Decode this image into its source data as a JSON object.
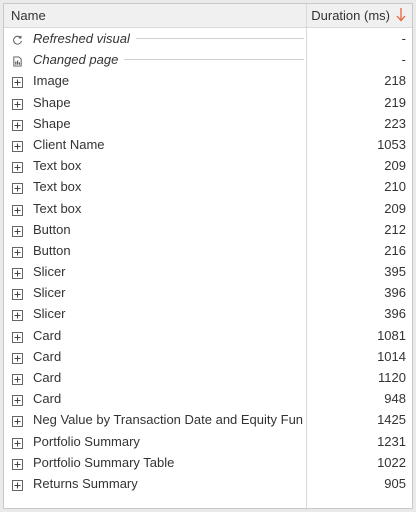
{
  "header": {
    "name_label": "Name",
    "duration_label": "Duration (ms)"
  },
  "rows": [
    {
      "label": "Refreshed visual",
      "value": "-",
      "icon": "refresh-icon",
      "italic": true
    },
    {
      "label": "Changed page",
      "value": "-",
      "icon": "page-icon",
      "italic": true
    },
    {
      "label": "Image",
      "value": "218",
      "icon": "expand-icon"
    },
    {
      "label": "Shape",
      "value": "219",
      "icon": "expand-icon"
    },
    {
      "label": "Shape",
      "value": "223",
      "icon": "expand-icon"
    },
    {
      "label": "Client Name",
      "value": "1053",
      "icon": "expand-icon"
    },
    {
      "label": "Text box",
      "value": "209",
      "icon": "expand-icon"
    },
    {
      "label": "Text box",
      "value": "210",
      "icon": "expand-icon"
    },
    {
      "label": "Text box",
      "value": "209",
      "icon": "expand-icon"
    },
    {
      "label": "Button",
      "value": "212",
      "icon": "expand-icon"
    },
    {
      "label": "Button",
      "value": "216",
      "icon": "expand-icon"
    },
    {
      "label": "Slicer",
      "value": "395",
      "icon": "expand-icon"
    },
    {
      "label": "Slicer",
      "value": "396",
      "icon": "expand-icon"
    },
    {
      "label": "Slicer",
      "value": "396",
      "icon": "expand-icon"
    },
    {
      "label": "Card",
      "value": "1081",
      "icon": "expand-icon"
    },
    {
      "label": "Card",
      "value": "1014",
      "icon": "expand-icon"
    },
    {
      "label": "Card",
      "value": "1120",
      "icon": "expand-icon"
    },
    {
      "label": "Card",
      "value": "948",
      "icon": "expand-icon"
    },
    {
      "label": "Neg Value by Transaction Date and Equity Fun...",
      "value": "1425",
      "icon": "expand-icon"
    },
    {
      "label": "Portfolio Summary",
      "value": "1231",
      "icon": "expand-icon"
    },
    {
      "label": "Portfolio Summary Table",
      "value": "1022",
      "icon": "expand-icon"
    },
    {
      "label": "Returns Summary",
      "value": "905",
      "icon": "expand-icon"
    }
  ],
  "colors": {
    "sort_arrow": "#e8643c",
    "text": "#333333",
    "header_bg": "#f0f0f0"
  }
}
